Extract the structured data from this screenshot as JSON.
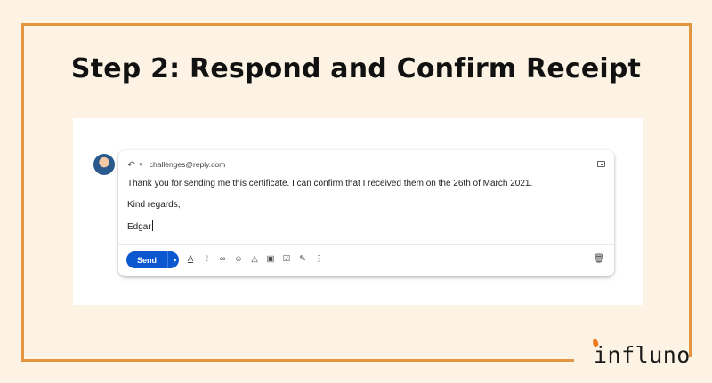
{
  "heading": "Step 2: Respond and Confirm Receipt",
  "email": {
    "recipient": "challenges@reply.com",
    "body_lines": [
      "Thank you for sending me this certificate. I can confirm that I received them on the 26th of March 2021.",
      "Kind regards,",
      "Edgar"
    ],
    "send_label": "Send"
  },
  "toolbar_icons": [
    "formatting-icon",
    "attach-icon",
    "link-icon",
    "emoji-icon",
    "drive-icon",
    "photo-icon",
    "confidential-icon",
    "signature-icon",
    "more-options-icon"
  ],
  "brand": {
    "logo_text": "influno"
  },
  "colors": {
    "frame": "#e2963f",
    "background": "#fdf3e5",
    "send_button": "#0b57d0",
    "logo_accent": "#ee7b1e"
  }
}
